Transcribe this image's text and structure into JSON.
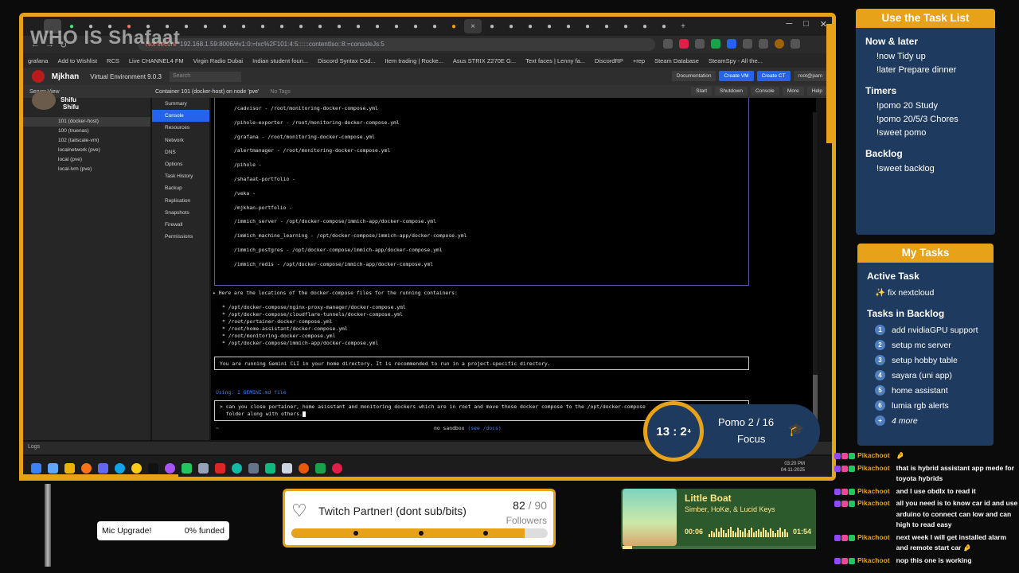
{
  "overlay": {
    "streamer_name": "WHO IS Shafaat"
  },
  "browser": {
    "url_warning": "Not secure",
    "url": "192.168.1.59:8006/#v1:0:=lxc%2F101:4:5::::::contentIso::8:=consoleJs:5",
    "bookmarks": [
      "grafana",
      "Add to Wishlist",
      "RCS",
      "Live CHANNEL4 FM",
      "Virgin Radio Dubai",
      "Indian student foun...",
      "Discord Syntax Cod...",
      "Item trading | Rocke...",
      "Asus STRIX Z270E G...",
      "Text faces | Lenny fa...",
      "DiscordRP",
      "+rep",
      "Steam Database",
      "SteamSpy - All the..."
    ]
  },
  "pve": {
    "user": "Mjkhan",
    "version": "Virtual Environment 9.0.3",
    "search_placeholder": "Search",
    "header_buttons": [
      "Documentation",
      "Create VM",
      "Create CT",
      "root@pam"
    ],
    "server_view": "Server View",
    "container_title": "Container 101 (docker-host) on node 'pve'",
    "no_tags": "No Tags",
    "actions": [
      "Start",
      "Shutdown",
      "Console",
      "More",
      "Help"
    ],
    "tree_root": "Shifu",
    "tree": [
      "101 (docker-host)",
      "100 (truenas)",
      "102 (tailscale-vm)",
      "localnetwork (pve)",
      "local (pve)",
      "local-lvm (pve)"
    ],
    "menu": [
      "Summary",
      "Console",
      "Resources",
      "Network",
      "DNS",
      "Options",
      "Task History",
      "Backup",
      "Replication",
      "Snapshots",
      "Firewall",
      "Permissions"
    ],
    "logs_label": "Logs"
  },
  "terminal": {
    "compose_map": [
      "/cadvisor - /root/monitoring-docker-compose.yml",
      "/pihole-exporter - /root/monitoring-docker-compose.yml",
      "/grafana - /root/monitoring-docker-compose.yml",
      "/alertmanager - /root/monitoring-docker-compose.yml",
      "/pihole -",
      "/shafaat-portfolio -",
      "/veka -",
      "/mjkhan-portfolio -",
      "/immich_server - /opt/docker-compose/immich-app/docker-compose.yml",
      "/immich_machine_learning - /opt/docker-compose/immich-app/docker-compose.yml",
      "/immich_postgres - /opt/docker-compose/immich-app/docker-compose.yml",
      "/immich_redis - /opt/docker-compose/immich-app/docker-compose.yml"
    ],
    "result_head": "✦ Here are the locations of the docker-compose files for the running containers:",
    "result_list": [
      "* /opt/docker-compose/nginx-proxy-manager/docker-compose.yml",
      "* /opt/docker-compose/cloudflare-tunnels/docker-compose.yml",
      "* /root/portainer-docker-compose.yml",
      "* /root/home-assistant/docker-compose.yml",
      "* /root/monitoring-docker-compose.yml",
      "* /opt/docker-compose/immich-app/docker-compose.yml"
    ],
    "warning": "You are running Gemini CLI in your home directory. It is recommended to run in a project-specific directory.",
    "using": "Using: 1 GEMINI.md file",
    "prompt": "> can you close portainer, home asisstant and monitoring dockers which are in root and move those docker compose to the /opt/docker-compose\n  folder along with others.",
    "cwd": "~",
    "sandbox": "no sandbox",
    "sandbox_hint": "(see /docs)"
  },
  "taskbar": {
    "time": "03:20 PM",
    "date": "04-11-2025"
  },
  "task_list": {
    "title": "Use the Task List",
    "sections": [
      {
        "heading": "Now & later",
        "cmds": [
          "!now Tidy up",
          "!later Prepare dinner"
        ]
      },
      {
        "heading": "Timers",
        "cmds": [
          "!pomo 20 Study",
          "!pomo 20/5/3 Chores",
          "!sweet pomo"
        ]
      },
      {
        "heading": "Backlog",
        "cmds": [
          "!sweet backlog"
        ]
      }
    ]
  },
  "my_tasks": {
    "title": "My Tasks",
    "active_heading": "Active Task",
    "active": "✨ fix nextcloud",
    "backlog_heading": "Tasks in Backlog",
    "backlog": [
      {
        "num": "1",
        "label": "add nvidiaGPU support"
      },
      {
        "num": "2",
        "label": "setup mc server"
      },
      {
        "num": "3",
        "label": "setup hobby table"
      },
      {
        "num": "4",
        "label": "sayara (uni app)"
      },
      {
        "num": "5",
        "label": "home assistant"
      },
      {
        "num": "6",
        "label": "lumia rgb alerts"
      },
      {
        "num": "+",
        "label": "4 more"
      }
    ]
  },
  "pomodoro": {
    "time_main": "13 : 2",
    "time_sub": "4",
    "label": "Pomo  2  / 16",
    "mode": "Focus"
  },
  "chat": [
    {
      "user": "Pikachoot",
      "text": "🤌"
    },
    {
      "user": "Pikachoot",
      "text": "that is hybrid assistant app mede for toyota hybrids"
    },
    {
      "user": "Pikachoot",
      "text": "and I use obdlx to read it"
    },
    {
      "user": "Pikachoot",
      "text": "all you need is to know car id and use arduino to connect can low and can high to read easy"
    },
    {
      "user": "Pikachoot",
      "text": "next week I will get installed alarm and remote start car 🤌"
    },
    {
      "user": "Pikachoot",
      "text": "nop this one is working"
    }
  ],
  "mic_goal": {
    "label": "Mic Upgrade!",
    "funded": "0% funded"
  },
  "partner_goal": {
    "title": "Twitch Partner! (dont sub/bits)",
    "current": "82",
    "target": "/ 90",
    "unit": "Followers",
    "progress": 0.911
  },
  "music": {
    "title": "Little Boat",
    "artist": "Simber, HoKø, & Lucid Keys",
    "position": "00:06",
    "length": "01:54",
    "progress": 0.05
  },
  "colors": {
    "accent": "#e8a21a",
    "panel": "#1f3a5f",
    "chat_user": "#e8a21a"
  }
}
